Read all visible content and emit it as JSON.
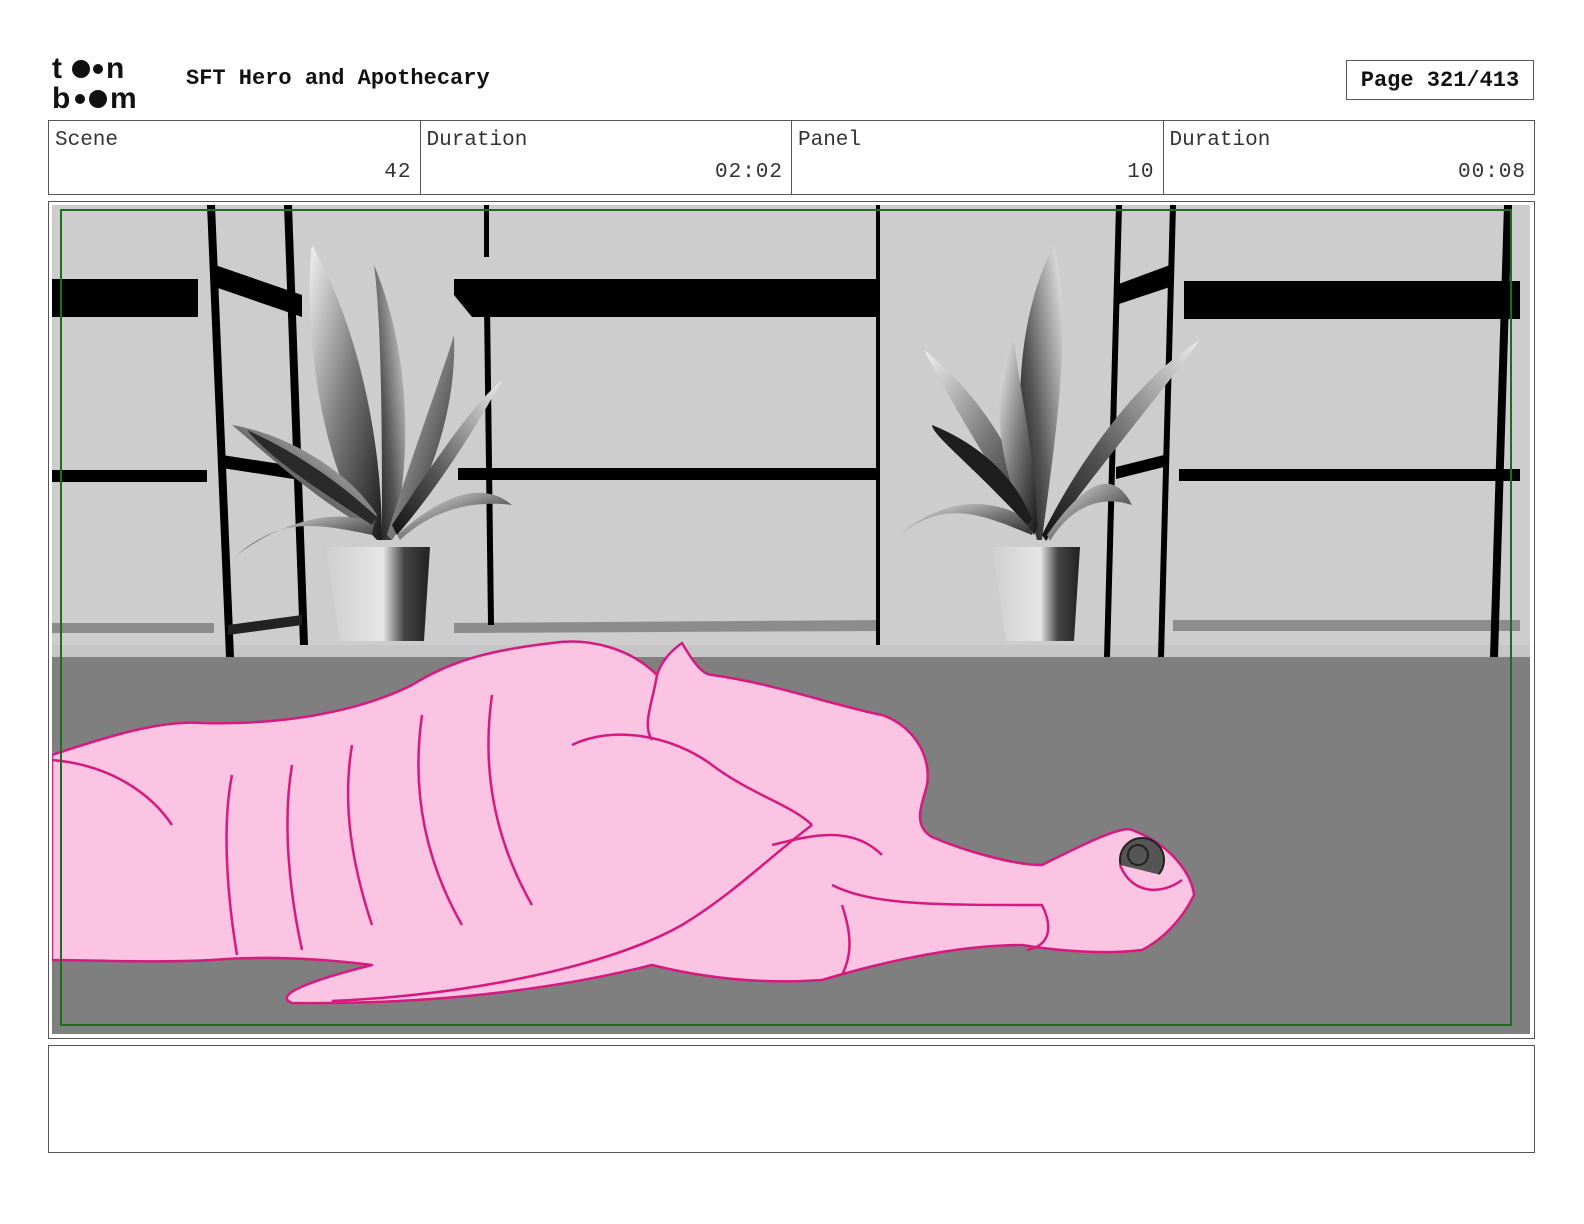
{
  "header": {
    "logo_text_top": "toon",
    "logo_text_bottom": "boom",
    "project_title": "SFT Hero and Apothecary",
    "page_label": "Page",
    "page_value": "321/413"
  },
  "info": {
    "scene_label": "Scene",
    "scene_value": "42",
    "scene_duration_label": "Duration",
    "scene_duration_value": "02:02",
    "panel_label": "Panel",
    "panel_value": "10",
    "panel_duration_label": "Duration",
    "panel_duration_value": "00:08"
  },
  "panel": {
    "safe_frame_color": "#1f6b1f",
    "character_fill": "#fbc4e3",
    "character_line": "#d61a7f",
    "floor_color": "#7f7f7f",
    "wall_color": "#cccccc"
  },
  "notes": {
    "text": ""
  }
}
